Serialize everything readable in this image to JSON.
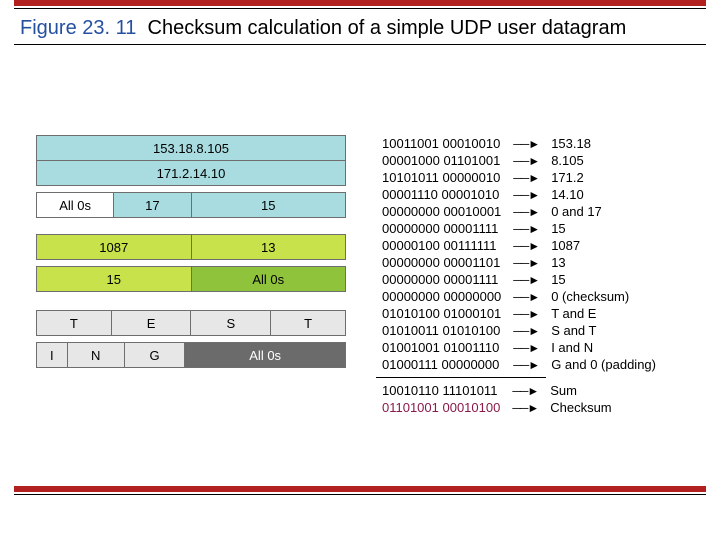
{
  "title": {
    "fig": "Figure 23. 11",
    "caption": "Checksum calculation of a simple UDP user datagram"
  },
  "left": {
    "src_ip": "153.18.8.105",
    "dst_ip": "171.2.14.10",
    "row3": {
      "a": "All 0s",
      "b": "17",
      "c": "15"
    },
    "row4": {
      "a": "1087",
      "b": "13"
    },
    "row5": {
      "a": "15",
      "b": "All 0s"
    },
    "row6": {
      "a": "T",
      "b": "E",
      "c": "S",
      "d": "T"
    },
    "row7": {
      "a": "I",
      "b": "N",
      "c": "G",
      "d": "All 0s"
    }
  },
  "calc": [
    {
      "b": "10011001 00010010",
      "d": "153.18"
    },
    {
      "b": "00001000 01101001",
      "d": "8.105"
    },
    {
      "b": "10101011 00000010",
      "d": "171.2"
    },
    {
      "b": "00001110 00001010",
      "d": "14.10"
    },
    {
      "b": "00000000 00010001",
      "d": "0 and 17"
    },
    {
      "b": "00000000 00001111",
      "d": "15"
    },
    {
      "b": "00000100 00111111",
      "d": "1087"
    },
    {
      "b": "00000000 00001101",
      "d": "13"
    },
    {
      "b": "00000000 00001111",
      "d": "15"
    },
    {
      "b": "00000000 00000000",
      "d": "0 (checksum)"
    },
    {
      "b": "01010100 01000101",
      "d": "T and E"
    },
    {
      "b": "01010011 01010100",
      "d": "S and T"
    },
    {
      "b": "01001001 01001110",
      "d": "I and N"
    },
    {
      "b": "01000111 00000000",
      "d": "G and 0 (padding)"
    }
  ],
  "sum": {
    "b": "10010110 11101011",
    "d": "Sum"
  },
  "checksum": {
    "b": "01101001 00010100",
    "d": "Checksum"
  }
}
